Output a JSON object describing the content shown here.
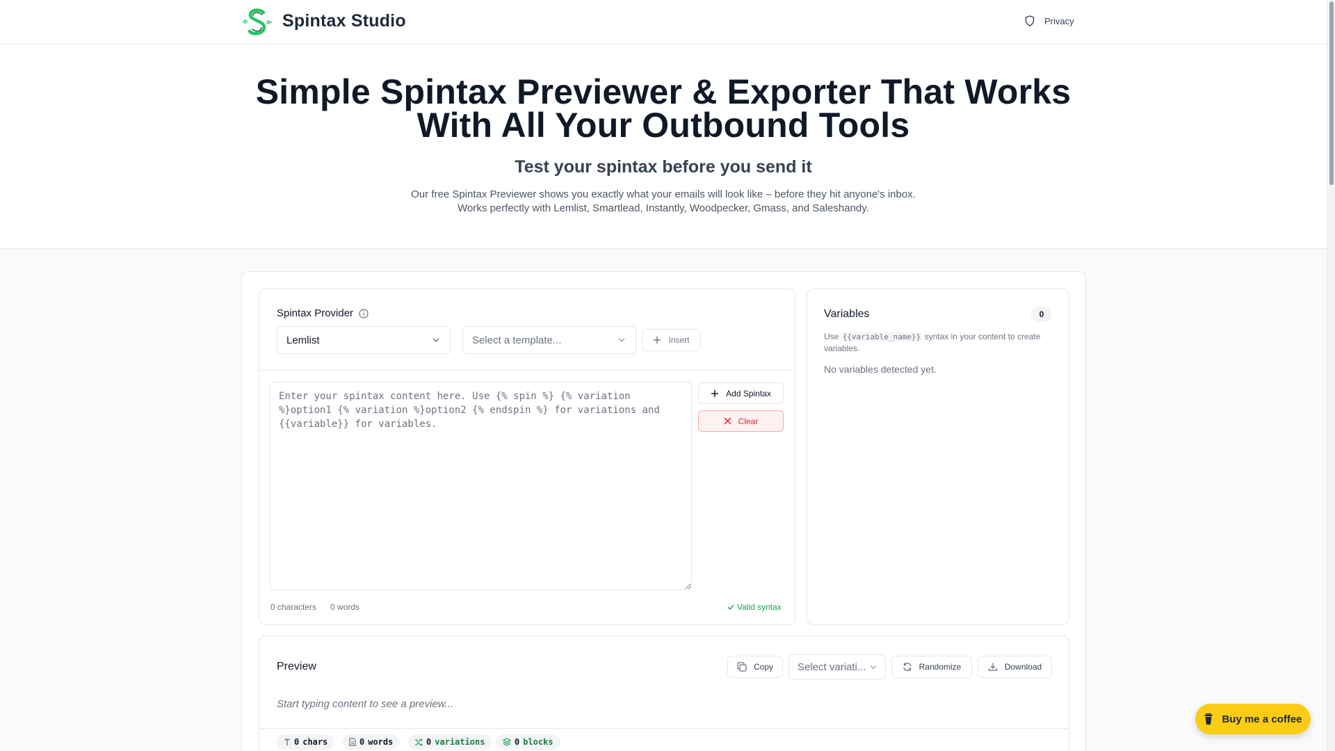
{
  "header": {
    "brand": "Spintax Studio",
    "privacy_label": "Privacy"
  },
  "hero": {
    "title_line1": "Simple Spintax Previewer & Exporter That Works",
    "title_line2": "With All Your Outbound Tools",
    "subtitle": "Test your spintax before you send it",
    "description": "Our free Spintax Previewer shows you exactly what your emails will look like – before they hit anyone's inbox. Works perfectly with Lemlist, Smartlead, Instantly, Woodpecker, Gmass, and Saleshandy."
  },
  "editor": {
    "provider_label": "Spintax Provider",
    "provider_value": "Lemlist",
    "template_placeholder": "Select a template...",
    "insert_label": "Insert",
    "textarea_placeholder": "Enter your spintax content here. Use {% spin %} {% variation %}option1 {% variation %}option2 {% endspin %} for variations and {{variable}} for variables.",
    "add_spintax_label": "Add Spintax",
    "clear_label": "Clear",
    "char_count": "0 characters",
    "word_count": "0 words",
    "syntax_status": "Valid syntax"
  },
  "variables": {
    "title": "Variables",
    "count": "0",
    "hint_prefix": "Use",
    "hint_code": "{{variable_name}}",
    "hint_suffix": "syntax in your content to create variables.",
    "empty_text": "No variables detected yet."
  },
  "preview": {
    "title": "Preview",
    "copy_label": "Copy",
    "variation_placeholder": "Select variati...",
    "randomize_label": "Randomize",
    "download_label": "Download",
    "empty_text": "Start typing content to see a preview...",
    "stats": {
      "chars_num": "0",
      "chars_label": "chars",
      "words_num": "0",
      "words_label": "words",
      "variations_num": "0",
      "variations_label": "variations",
      "blocks_num": "0",
      "blocks_label": "blocks"
    }
  },
  "coffee": {
    "label": "Buy me a coffee"
  },
  "colors": {
    "brand_green": "#22c55e",
    "valid_green": "#16a34a",
    "clear_red": "#dc2626",
    "coffee_yellow": "#facc15"
  }
}
